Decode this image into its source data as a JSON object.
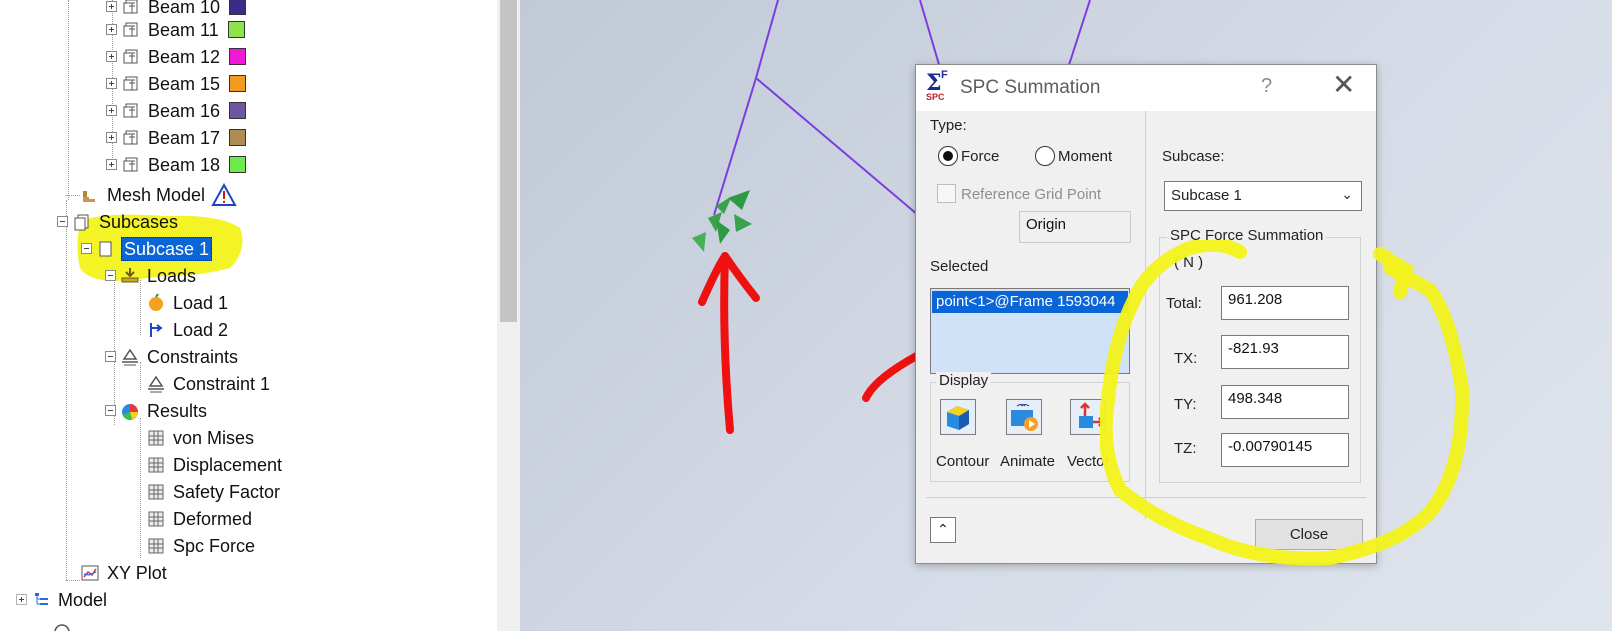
{
  "tree": {
    "beams": [
      {
        "label": "Beam 10",
        "color": "#3a2a8a"
      },
      {
        "label": "Beam 11",
        "color": "#8ee24a"
      },
      {
        "label": "Beam 12",
        "color": "#ee1ad7"
      },
      {
        "label": "Beam 15",
        "color": "#f39a20"
      },
      {
        "label": "Beam 16",
        "color": "#6e56a0"
      },
      {
        "label": "Beam 17",
        "color": "#ae8d52"
      },
      {
        "label": "Beam 18",
        "color": "#6ee84a"
      }
    ],
    "mesh_model": "Mesh Model",
    "subcases": "Subcases",
    "subcase_1": "Subcase 1",
    "loads": "Loads",
    "load_1": "Load 1",
    "load_2": "Load 2",
    "constraints": "Constraints",
    "constraint_1": "Constraint 1",
    "results": "Results",
    "result_items": [
      "von Mises",
      "Displacement",
      "Safety Factor",
      "Deformed",
      "Spc Force"
    ],
    "xy_plot": "XY Plot",
    "model": "Model",
    "highlight_color": "#f2f21a",
    "selection_color": "#0a66d6"
  },
  "dialog": {
    "title": "SPC Summation",
    "help": "?",
    "close_x": "✕",
    "type_label": "Type:",
    "force_label": "Force",
    "moment_label": "Moment",
    "type_selected": "Force",
    "reference_grid_point_label": "Reference Grid Point",
    "reference_grid_point_checked": false,
    "origin_value": "Origin",
    "selected_label": "Selected",
    "selected_item": "point<1>@Frame 1593044",
    "display_label": "Display",
    "contour_label": "Contour",
    "animate_label": "Animate",
    "vector_label": "Vector",
    "subcase_label": "Subcase:",
    "subcase_value": "Subcase 1",
    "force_summation_label": "SPC Force Summation",
    "units": "( N )",
    "total_label": "Total:",
    "total_value": "961.208",
    "tx_label": "TX:",
    "tx_value": "-821.93",
    "ty_label": "TY:",
    "ty_value": "498.348",
    "tz_label": "TZ:",
    "tz_value": "-0.00790145",
    "close_button": "Close",
    "collapse_icon": "⌃"
  },
  "annotations": {
    "arrow_color": "#ef1010",
    "highlight_color": "#f2f21a",
    "frame_line_color": "#7a3ee0",
    "constraint_marker_color": "#3aa24a"
  }
}
